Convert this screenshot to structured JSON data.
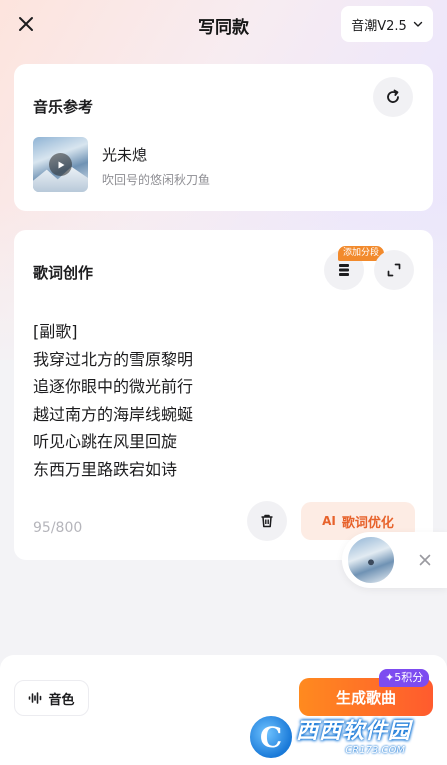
{
  "header": {
    "title": "写同款",
    "model_label": "音潮V2.5"
  },
  "music_ref": {
    "title": "音乐参考",
    "song_name": "光未熄",
    "author": "吹回号的悠闲秋刀鱼"
  },
  "lyrics": {
    "title": "歌词创作",
    "add_section_badge": "添加分段",
    "lines": [
      "[副歌]",
      "我穿过北方的雪原黎明",
      "追逐你眼中的微光前行",
      "越过南方的海岸线蜿蜒",
      "听见心跳在风里回旋",
      "东西万里路跌宕如诗"
    ],
    "counter": "95/800",
    "optimize_label": "歌词优化",
    "optimize_ai_mark": "AI"
  },
  "bottom": {
    "timbre_label": "音色",
    "generate_label": "生成歌曲",
    "points_badge": "✦5积分"
  },
  "watermark": {
    "logo_letter": "C",
    "main": "西西软件园",
    "sub": "CR173.COM"
  },
  "colors": {
    "accent_orange": "#ff6a25",
    "badge_orange": "#f28a2c",
    "points_purple": "#7d4cf0",
    "optimize_bg": "#fdece4"
  },
  "icons": {
    "close": "close-icon",
    "chevron": "chevron-down-icon",
    "refresh": "refresh-icon",
    "section": "section-icon",
    "expand": "expand-icon",
    "trash": "trash-icon",
    "waveform": "waveform-icon",
    "play": "play-icon"
  }
}
